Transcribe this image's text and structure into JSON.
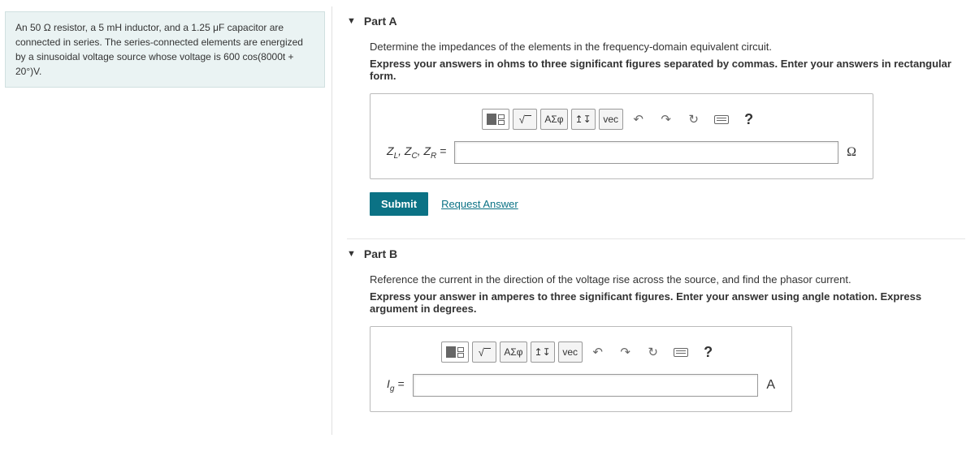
{
  "problem_context_html": "An 50 Ω resistor, a 5 mH inductor, and a 1.25 μF capacitor are connected in series. The series-connected elements are energized by a sinusoidal voltage source whose voltage is 600 cos(8000t + 20°)V.",
  "parts": {
    "a": {
      "title": "Part A",
      "prompt": "Determine the impedances of the elements in the frequency-domain equivalent circuit.",
      "instruction": "Express your answers in ohms to three significant figures separated by commas. Enter your answers in rectangular form.",
      "lhs_html": "Z<span class='sub'>L</span>, Z<span class='sub'>C</span>, Z<span class='sub'>R</span> =",
      "unit": "Ω",
      "value": ""
    },
    "b": {
      "title": "Part B",
      "prompt": "Reference the current in the direction of the voltage rise across the source, and find the phasor current.",
      "instruction": "Express your answer in amperes to three significant figures. Enter your answer using angle notation. Express argument in degrees.",
      "lhs_html": "I<span class='sub'>g</span> =",
      "unit": "A",
      "value": ""
    }
  },
  "toolbar": {
    "greek": "ΑΣφ",
    "arrows": "↥↧",
    "vec": "vec",
    "undo": "↶",
    "redo": "↷",
    "reset": "↻",
    "help": "?"
  },
  "buttons": {
    "submit": "Submit",
    "request": "Request Answer"
  }
}
